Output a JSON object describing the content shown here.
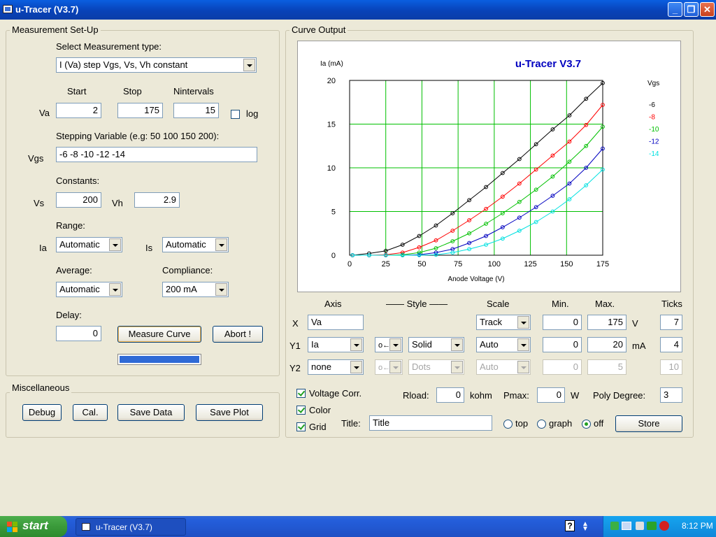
{
  "window": {
    "title": "u-Tracer (V3.7)"
  },
  "setup": {
    "group_label": "Measurement Set-Up",
    "meas_type_label": "Select Measurement type:",
    "meas_type_value": "I (Va) step Vgs, Vs, Vh constant",
    "start_header": "Start",
    "stop_header": "Stop",
    "nint_header": "Nintervals",
    "va_label": "Va",
    "va_start": "2",
    "va_stop": "175",
    "va_nint": "15",
    "log_label": "log",
    "stepping_label": "Stepping Variable (e.g: 50 100 150 200):",
    "vgs_label": "Vgs",
    "vgs_value": "-6 -8 -10 -12 -14",
    "constants_label": "Constants:",
    "vs_label": "Vs",
    "vs_value": "200",
    "vh_label": "Vh",
    "vh_value": "2.9",
    "range_label": "Range:",
    "ia_label": "Ia",
    "ia_range": "Automatic",
    "is_label": "Is",
    "is_range": "Automatic",
    "average_label": "Average:",
    "average_value": "Automatic",
    "compliance_label": "Compliance:",
    "compliance_value": "200 mA",
    "delay_label": "Delay:",
    "delay_value": "0",
    "measure_button": "Measure Curve",
    "abort_button": "Abort !",
    "progress": 1.0
  },
  "misc": {
    "group_label": "Miscellaneous",
    "debug": "Debug",
    "cal": "Cal.",
    "save_data": "Save Data",
    "save_plot": "Save Plot"
  },
  "curve_output": {
    "group_label": "Curve Output",
    "axis_header": "Axis",
    "style_header": "—— Style ——",
    "scale_header": "Scale",
    "min_header": "Min.",
    "max_header": "Max.",
    "ticks_header": "Ticks",
    "x": {
      "label": "X",
      "axis": "Va",
      "scale": "Track",
      "min": "0",
      "max": "175",
      "unit": "V",
      "ticks": "7"
    },
    "y1": {
      "label": "Y1",
      "axis": "Ia",
      "marker": "o←",
      "style": "Solid",
      "scale": "Auto",
      "min": "0",
      "max": "20",
      "unit": "mA",
      "ticks": "4"
    },
    "y2": {
      "label": "Y2",
      "axis": "none",
      "marker": "o←",
      "style": "Dots",
      "scale": "Auto",
      "min": "0",
      "max": "5",
      "ticks": "10"
    },
    "voltage_corr": "Voltage Corr.",
    "color": "Color",
    "grid": "Grid",
    "rload_label": "Rload:",
    "rload_value": "0",
    "rload_unit": "kohm",
    "pmax_label": "Pmax:",
    "pmax_value": "0",
    "pmax_unit": "W",
    "poly_label": "Poly Degree:",
    "poly_value": "3",
    "title_label": "Title:",
    "title_value": "Title",
    "radio_top": "top",
    "radio_graph": "graph",
    "radio_off": "off",
    "store": "Store"
  },
  "chart_data": {
    "type": "line",
    "title": "u-Tracer V3.7",
    "xlabel": "Anode Voltage (V)",
    "ylabel": "Ia (mA)",
    "xlim": [
      0,
      175
    ],
    "ylim": [
      0,
      20
    ],
    "xticks": [
      0,
      25,
      50,
      75,
      100,
      125,
      150,
      175
    ],
    "yticks": [
      0,
      5,
      10,
      15,
      20
    ],
    "grid": true,
    "legend_title": "Vgs",
    "x": [
      2,
      13.5,
      25,
      36.6,
      48.1,
      59.7,
      71.2,
      82.7,
      94.3,
      105.8,
      117.4,
      128.9,
      140.4,
      152,
      163.5,
      175
    ],
    "series": [
      {
        "name": "-6",
        "color": "#000000",
        "values": [
          0,
          0.2,
          0.5,
          1.2,
          2.2,
          3.4,
          4.8,
          6.3,
          7.8,
          9.4,
          11.0,
          12.7,
          14.4,
          16.0,
          17.9,
          19.7
        ]
      },
      {
        "name": "-8",
        "color": "#ff0000",
        "values": [
          0,
          0,
          0.05,
          0.3,
          0.9,
          1.7,
          2.8,
          4.0,
          5.3,
          6.7,
          8.2,
          9.8,
          11.4,
          13.0,
          14.9,
          17.2
        ]
      },
      {
        "name": "-10",
        "color": "#00c000",
        "values": [
          0,
          0,
          0,
          0.05,
          0.3,
          0.8,
          1.6,
          2.5,
          3.6,
          4.8,
          6.1,
          7.5,
          9.0,
          10.7,
          12.5,
          14.7
        ]
      },
      {
        "name": "-12",
        "color": "#0000c0",
        "values": [
          0,
          0,
          0,
          0,
          0.05,
          0.3,
          0.7,
          1.4,
          2.2,
          3.2,
          4.3,
          5.5,
          6.8,
          8.2,
          10.0,
          12.2
        ]
      },
      {
        "name": "-14",
        "color": "#00e0e0",
        "values": [
          0,
          0,
          0,
          0,
          0,
          0.05,
          0.3,
          0.7,
          1.2,
          1.9,
          2.8,
          3.8,
          5.0,
          6.4,
          8.0,
          9.8
        ]
      }
    ]
  },
  "taskbar": {
    "start": "start",
    "task": "u-Tracer (V3.7)",
    "clock": "8:12 PM"
  },
  "colors": {
    "accent": "#0a246a",
    "progress": "#2f6ad6",
    "titlebar": "#0842b8"
  }
}
